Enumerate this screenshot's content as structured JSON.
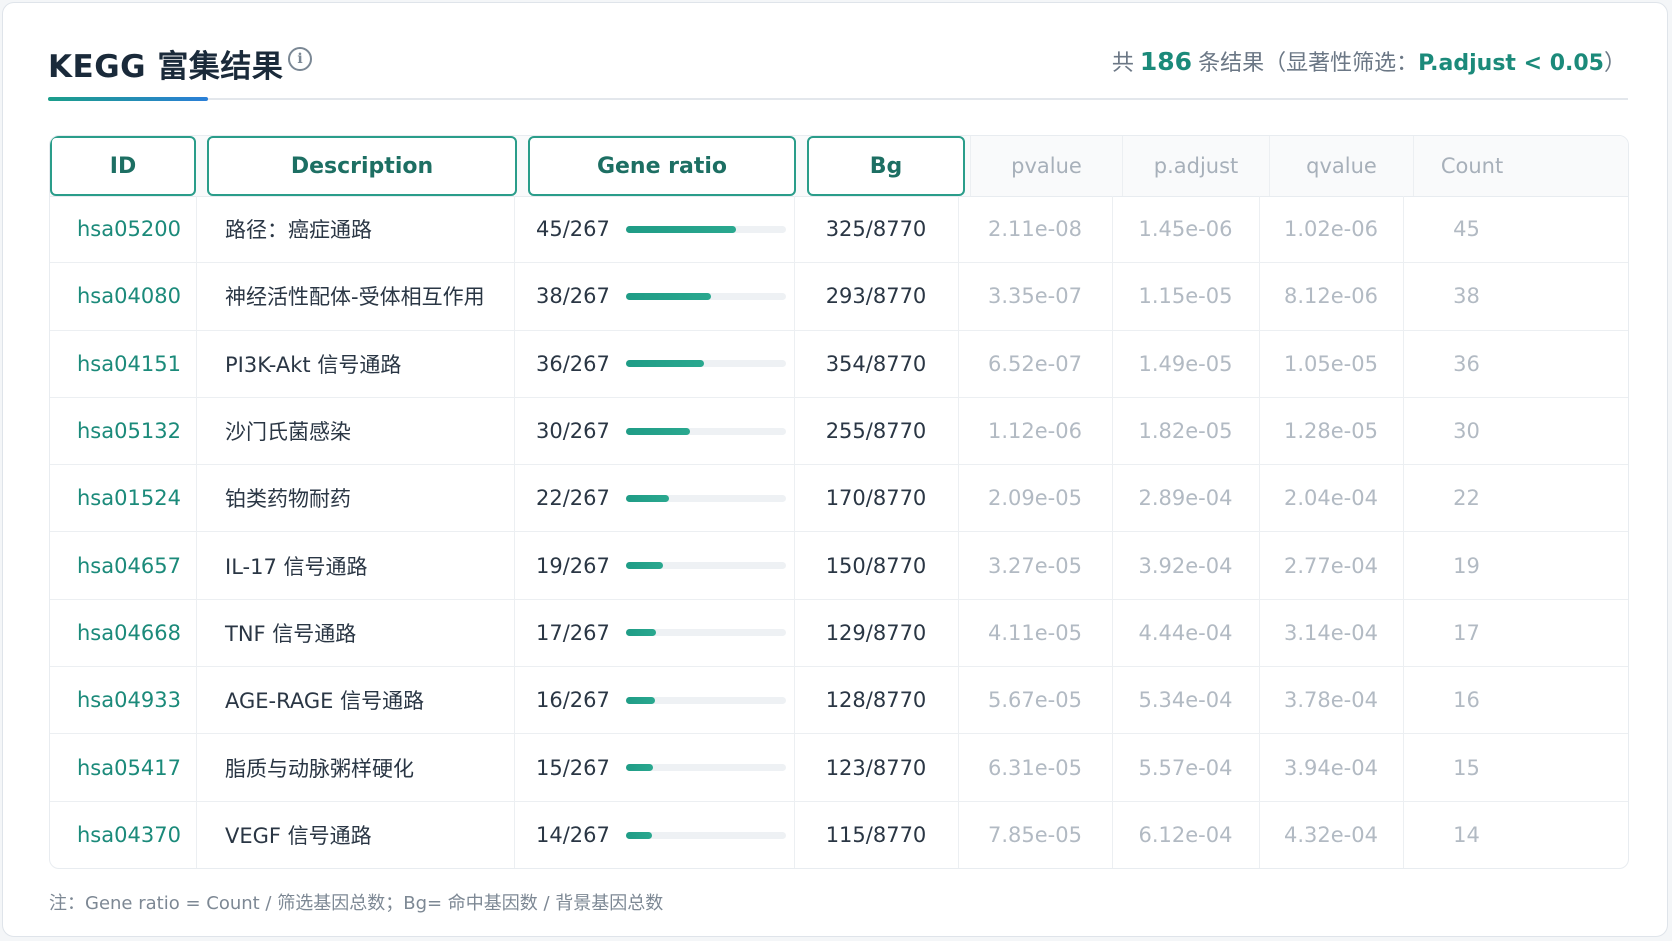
{
  "header": {
    "title": "KEGG 富集结果",
    "info_icon": "i",
    "summary_prefix": "共",
    "summary_count": "186",
    "summary_suffix": "条结果（显著性筛选：",
    "summary_threshold": "P.adjust < 0.05",
    "summary_close": "）"
  },
  "colors": {
    "accent": "#1b8a7a",
    "bar": "#1f9c86",
    "muted": "#b2bac3"
  },
  "table": {
    "columns": {
      "id": "ID",
      "description": "Description",
      "gene_ratio": "Gene ratio",
      "bg": "Bg",
      "pvalue": "pvalue",
      "padjust": "p.adjust",
      "qvalue": "qvalue",
      "count": "Count"
    },
    "rows": [
      {
        "id": "hsa05200",
        "description": "路径：癌症通路",
        "gene_ratio": "45/267",
        "ratio_fill": 0.69,
        "bg": "325/8770",
        "pvalue": "2.11e-08",
        "padjust": "1.45e-06",
        "qvalue": "1.02e-06",
        "count": "45"
      },
      {
        "id": "hsa04080",
        "description": "神经活性配体-受体相互作用",
        "gene_ratio": "38/267",
        "ratio_fill": 0.53,
        "bg": "293/8770",
        "pvalue": "3.35e-07",
        "padjust": "1.15e-05",
        "qvalue": "8.12e-06",
        "count": "38"
      },
      {
        "id": "hsa04151",
        "description": "PI3K-Akt 信号通路",
        "gene_ratio": "36/267",
        "ratio_fill": 0.49,
        "bg": "354/8770",
        "pvalue": "6.52e-07",
        "padjust": "1.49e-05",
        "qvalue": "1.05e-05",
        "count": "36"
      },
      {
        "id": "hsa05132",
        "description": "沙门氏菌感染",
        "gene_ratio": "30/267",
        "ratio_fill": 0.4,
        "bg": "255/8770",
        "pvalue": "1.12e-06",
        "padjust": "1.82e-05",
        "qvalue": "1.28e-05",
        "count": "30"
      },
      {
        "id": "hsa01524",
        "description": "铂类药物耐药",
        "gene_ratio": "22/267",
        "ratio_fill": 0.27,
        "bg": "170/8770",
        "pvalue": "2.09e-05",
        "padjust": "2.89e-04",
        "qvalue": "2.04e-04",
        "count": "22"
      },
      {
        "id": "hsa04657",
        "description": "IL-17 信号通路",
        "gene_ratio": "19/267",
        "ratio_fill": 0.23,
        "bg": "150/8770",
        "pvalue": "3.27e-05",
        "padjust": "3.92e-04",
        "qvalue": "2.77e-04",
        "count": "19"
      },
      {
        "id": "hsa04668",
        "description": "TNF 信号通路",
        "gene_ratio": "17/267",
        "ratio_fill": 0.19,
        "bg": "129/8770",
        "pvalue": "4.11e-05",
        "padjust": "4.44e-04",
        "qvalue": "3.14e-04",
        "count": "17"
      },
      {
        "id": "hsa04933",
        "description": "AGE-RAGE 信号通路",
        "gene_ratio": "16/267",
        "ratio_fill": 0.18,
        "bg": "128/8770",
        "pvalue": "5.67e-05",
        "padjust": "5.34e-04",
        "qvalue": "3.78e-04",
        "count": "16"
      },
      {
        "id": "hsa05417",
        "description": "脂质与动脉粥样硬化",
        "gene_ratio": "15/267",
        "ratio_fill": 0.17,
        "bg": "123/8770",
        "pvalue": "6.31e-05",
        "padjust": "5.57e-04",
        "qvalue": "3.94e-04",
        "count": "15"
      },
      {
        "id": "hsa04370",
        "description": "VEGF 信号通路",
        "gene_ratio": "14/267",
        "ratio_fill": 0.16,
        "bg": "115/8770",
        "pvalue": "7.85e-05",
        "padjust": "6.12e-04",
        "qvalue": "4.32e-04",
        "count": "14"
      }
    ]
  },
  "footnote": "注：Gene ratio = Count / 筛选基因总数；Bg= 命中基因数 / 背景基因总数"
}
